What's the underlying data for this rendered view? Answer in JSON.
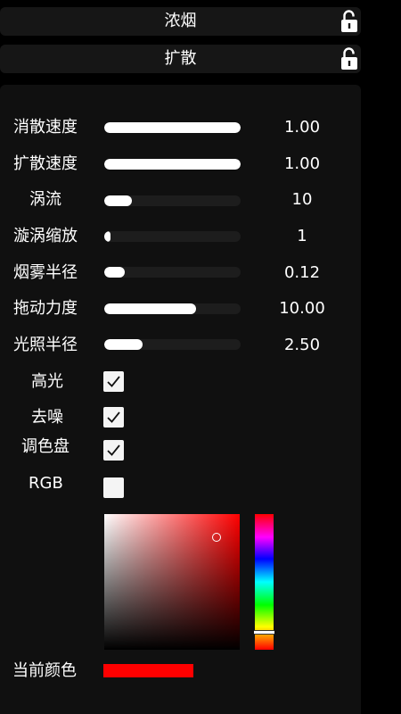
{
  "sections": [
    {
      "title": "浓烟",
      "icon": "unlock-icon"
    },
    {
      "title": "扩散",
      "icon": "unlock-icon"
    }
  ],
  "sliders": [
    {
      "label": "消散速度",
      "value": "1.00",
      "fraction": 1.0
    },
    {
      "label": "扩散速度",
      "value": "1.00",
      "fraction": 1.0
    },
    {
      "label": "涡流",
      "value": "10",
      "fraction": 0.2
    },
    {
      "label": "漩涡缩放",
      "value": "1",
      "fraction": 0.04
    },
    {
      "label": "烟雾半径",
      "value": "0.12",
      "fraction": 0.15
    },
    {
      "label": "拖动力度",
      "value": "10.00",
      "fraction": 0.67
    },
    {
      "label": "光照半径",
      "value": "2.50",
      "fraction": 0.28
    }
  ],
  "toggles": [
    {
      "label": "高光",
      "checked": true
    },
    {
      "label": "去噪",
      "checked": true
    },
    {
      "label": "调色盘",
      "checked": true
    },
    {
      "label": "RGB",
      "checked": false
    }
  ],
  "color_picker": {
    "hue_color": "#ff0000",
    "saturation": 0.83,
    "brightness": 0.83,
    "hue_position": 0.87
  },
  "current_color": {
    "label": "当前颜色",
    "color": "#ff0000"
  }
}
